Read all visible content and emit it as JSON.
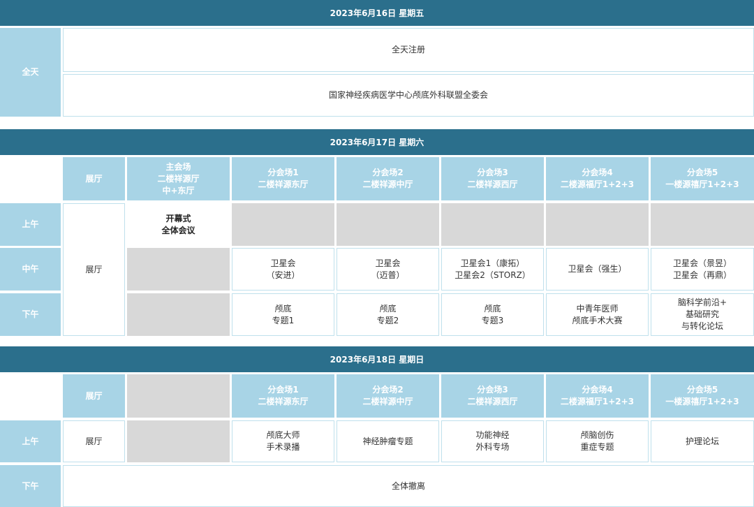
{
  "day1": {
    "header": "2023年6月16日  星期五",
    "row_label": "全天",
    "items": [
      "全天注册",
      "国家神经疾病医学中心颅底外科联盟全委会"
    ]
  },
  "day2": {
    "header": "2023年6月17日  星期六",
    "col_heads": [
      "展厅",
      "主会场\n二楼祥源厅\n中+东厅",
      "分会场1\n二楼祥源东厅",
      "分会场2\n二楼祥源中厅",
      "分会场3\n二楼祥源西厅",
      "分会场4\n二楼源福厅1+2+3",
      "分会场5\n一楼源禧厅1+2+3"
    ],
    "rows": [
      "上午",
      "中午",
      "下午"
    ],
    "exhibit": "展厅",
    "morning_main": "开幕式\n全体会议",
    "noon": [
      "卫星会\n（安进）",
      "卫星会\n（迈普）",
      "卫星会1（康拓）\n卫星会2（STORZ）",
      "卫星会（强生）",
      "卫星会（景昱）\n卫星会（再鼎）"
    ],
    "afternoon": [
      "颅底\n专题1",
      "颅底\n专题2",
      "颅底\n专题3",
      "中青年医师\n颅底手术大赛",
      "脑科学前沿+\n基础研究\n与转化论坛"
    ]
  },
  "day3": {
    "header": "2023年6月18日  星期日",
    "col_heads": [
      "展厅",
      "分会场1\n二楼祥源东厅",
      "分会场2\n二楼祥源中厅",
      "分会场3\n二楼祥源西厅",
      "分会场4\n二楼源福厅1+2+3",
      "分会场5\n一楼源禧厅1+2+3"
    ],
    "rows": [
      "上午",
      "下午"
    ],
    "morning": [
      "展厅",
      "颅底大师\n手术录播",
      "神经肿瘤专题",
      "功能神经\n外科专场",
      "颅脑创伤\n重症专题",
      "护理论坛"
    ],
    "afternoon_all": "全体撤离"
  },
  "colors": {
    "header_bg": "#2b6f8c",
    "label_bg": "#a8d4e6",
    "empty_bg": "#d8d8d8",
    "border": "#bfe0ec"
  }
}
